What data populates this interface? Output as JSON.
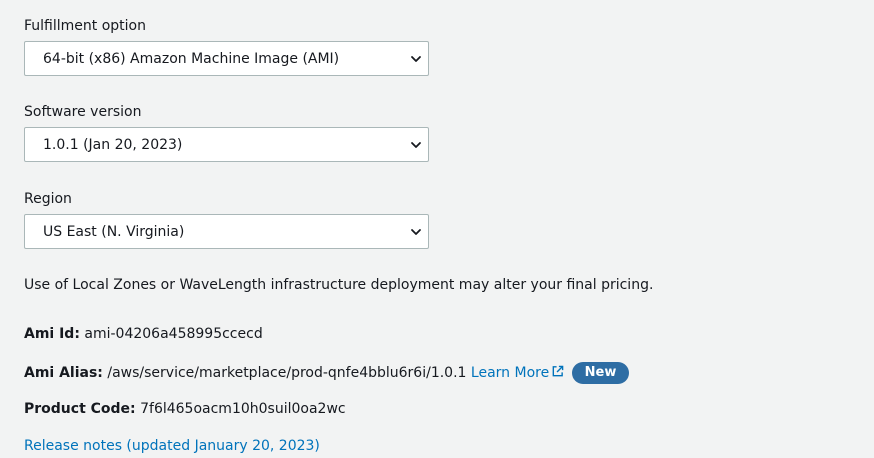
{
  "fulfillment": {
    "label": "Fulfillment option",
    "selected": "64-bit (x86) Amazon Machine Image (AMI)"
  },
  "software_version": {
    "label": "Software version",
    "selected": "1.0.1 (Jan 20, 2023)"
  },
  "region": {
    "label": "Region",
    "selected": "US East (N. Virginia)"
  },
  "pricing_note": "Use of Local Zones or WaveLength infrastructure deployment may alter your final pricing.",
  "ami_id": {
    "label": "Ami Id:",
    "value": "ami-04206a458995ccecd"
  },
  "ami_alias": {
    "label": "Ami Alias:",
    "value": "/aws/service/marketplace/prod-qnfe4bblu6r6i/1.0.1",
    "learn_more": "Learn More",
    "badge": "New"
  },
  "product_code": {
    "label": "Product Code:",
    "value": "7f6l465oacm10h0suil0oa2wc"
  },
  "release_notes": "Release notes (updated January 20, 2023)",
  "icons": {
    "dropdown": "chevron-down-icon",
    "external_link": "external-link-icon"
  },
  "colors": {
    "link": "#0073bb",
    "badge": "#2e6da4",
    "background": "#f2f3f3"
  }
}
